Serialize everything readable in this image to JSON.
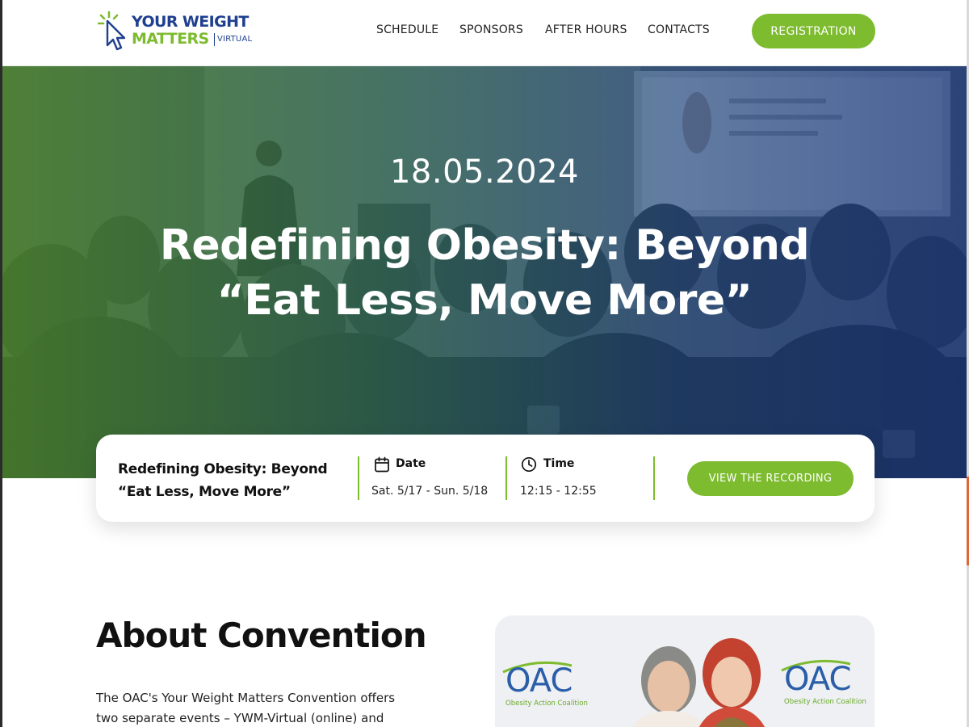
{
  "header": {
    "logo": {
      "line1": "YOUR WEIGHT",
      "line2": "MATTERS",
      "tag": "VIRTUAL"
    },
    "nav": [
      "SCHEDULE",
      "SPONSORS",
      "AFTER HOURS",
      "CONTACTS"
    ],
    "cta": "REGISTRATION"
  },
  "hero": {
    "date": "18.05.2024",
    "title": "Redefining Obesity: Beyond “Eat Less, Move More”"
  },
  "event_card": {
    "title": "Redefining Obesity: Beyond “Eat Less, Move More”",
    "date_label": "Date",
    "date_value": "Sat. 5/17 - Sun. 5/18",
    "time_label": "Time",
    "time_value": "12:15 - 12:55",
    "cta": "VIEW THE RECORDING",
    "icons": [
      "calendar-icon",
      "clock-icon"
    ]
  },
  "about": {
    "heading": "About Convention",
    "text": "The OAC's Your Weight Matters Convention offers two separate events – YWM-Virtual (online) and YWM-",
    "photo_banner": {
      "logo_text": "OAC",
      "logo_sub": "Obesity Action Coalition"
    }
  },
  "colors": {
    "brand_green": "#7dbb2f",
    "brand_blue": "#1f3f8f",
    "hero_gradient_start": "#488228",
    "hero_gradient_end": "#12307a"
  }
}
